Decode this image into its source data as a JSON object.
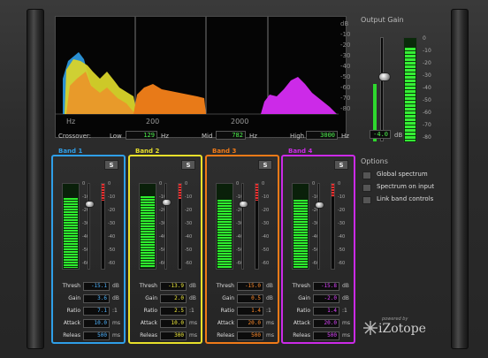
{
  "spectrum": {
    "db_labels": [
      "dB",
      "-10",
      "-20",
      "-30",
      "-40",
      "-50",
      "-60",
      "-70",
      "-80"
    ],
    "hz_labels": [
      "Hz",
      "200",
      "2000"
    ]
  },
  "output_gain": {
    "title": "Output Gain",
    "value": "-4.0",
    "unit": "dB",
    "fader_level": 0.62,
    "meter_level": 0.9,
    "scale": [
      "0",
      "-10",
      "-20",
      "-30",
      "-40",
      "-50",
      "-60",
      "-70",
      "-80"
    ]
  },
  "crossover": {
    "label": "Crossover:",
    "low_label": "Low",
    "low_value": "129",
    "low_unit": "Hz",
    "mid_label": "Mid",
    "mid_value": "782",
    "mid_unit": "Hz",
    "high_label": "High",
    "high_value": "3000",
    "high_unit": "Hz"
  },
  "options": {
    "title": "Options",
    "items": [
      {
        "label": "Global spectrum"
      },
      {
        "label": "Spectrum on input"
      },
      {
        "label": "Link band controls"
      }
    ]
  },
  "meter_scale": [
    "0",
    "-10",
    "-20",
    "-30",
    "-40",
    "-50",
    "-60"
  ],
  "gr_scale": [
    "0",
    "-10",
    "-20",
    "-30",
    "-40",
    "-50",
    "-60"
  ],
  "solo_label": "S",
  "bands": [
    {
      "title": "Band 1",
      "color": "#2f9fe8",
      "value_color": "#4fb4ff",
      "meter_level": 0.82,
      "gr_level": 0.2,
      "threshold_level": 0.24,
      "params": [
        {
          "label": "Thresh",
          "value": "-15.1",
          "unit": "dB"
        },
        {
          "label": "Gain",
          "value": "3.6",
          "unit": "dB"
        },
        {
          "label": "Ratio",
          "value": "7.1",
          "unit": ":1"
        },
        {
          "label": "Attack",
          "value": "10.0",
          "unit": "ms"
        },
        {
          "label": "Releas",
          "value": "500",
          "unit": "ms"
        }
      ]
    },
    {
      "title": "Band 2",
      "color": "#e8e02a",
      "value_color": "#f2ec3a",
      "meter_level": 0.84,
      "gr_level": 0.18,
      "threshold_level": 0.22,
      "params": [
        {
          "label": "Thresh",
          "value": "-13.9",
          "unit": "dB"
        },
        {
          "label": "Gain",
          "value": "2.0",
          "unit": "dB"
        },
        {
          "label": "Ratio",
          "value": "2.5",
          "unit": ":1"
        },
        {
          "label": "Attack",
          "value": "10.0",
          "unit": "ms"
        },
        {
          "label": "Releas",
          "value": "300",
          "unit": "ms"
        }
      ]
    },
    {
      "title": "Band 3",
      "color": "#f07a18",
      "value_color": "#ff8a2a",
      "meter_level": 0.8,
      "gr_level": 0.2,
      "threshold_level": 0.24,
      "params": [
        {
          "label": "Thresh",
          "value": "-15.0",
          "unit": "dB"
        },
        {
          "label": "Gain",
          "value": "0.5",
          "unit": "dB"
        },
        {
          "label": "Ratio",
          "value": "1.4",
          "unit": ":1"
        },
        {
          "label": "Attack",
          "value": "20.0",
          "unit": "ms"
        },
        {
          "label": "Releas",
          "value": "500",
          "unit": "ms"
        }
      ]
    },
    {
      "title": "Band 4",
      "color": "#cc2ae8",
      "value_color": "#dd44ff",
      "meter_level": 0.8,
      "gr_level": 0.16,
      "threshold_level": 0.25,
      "params": [
        {
          "label": "Thresh",
          "value": "-15.8",
          "unit": "dB"
        },
        {
          "label": "Gain",
          "value": "-2.0",
          "unit": "dB"
        },
        {
          "label": "Ratio",
          "value": "1.4",
          "unit": ":1"
        },
        {
          "label": "Attack",
          "value": "20.0",
          "unit": "ms"
        },
        {
          "label": "Releas",
          "value": "500",
          "unit": "ms"
        }
      ]
    }
  ],
  "logo": {
    "powered": "powered by",
    "name": "iZotope"
  }
}
